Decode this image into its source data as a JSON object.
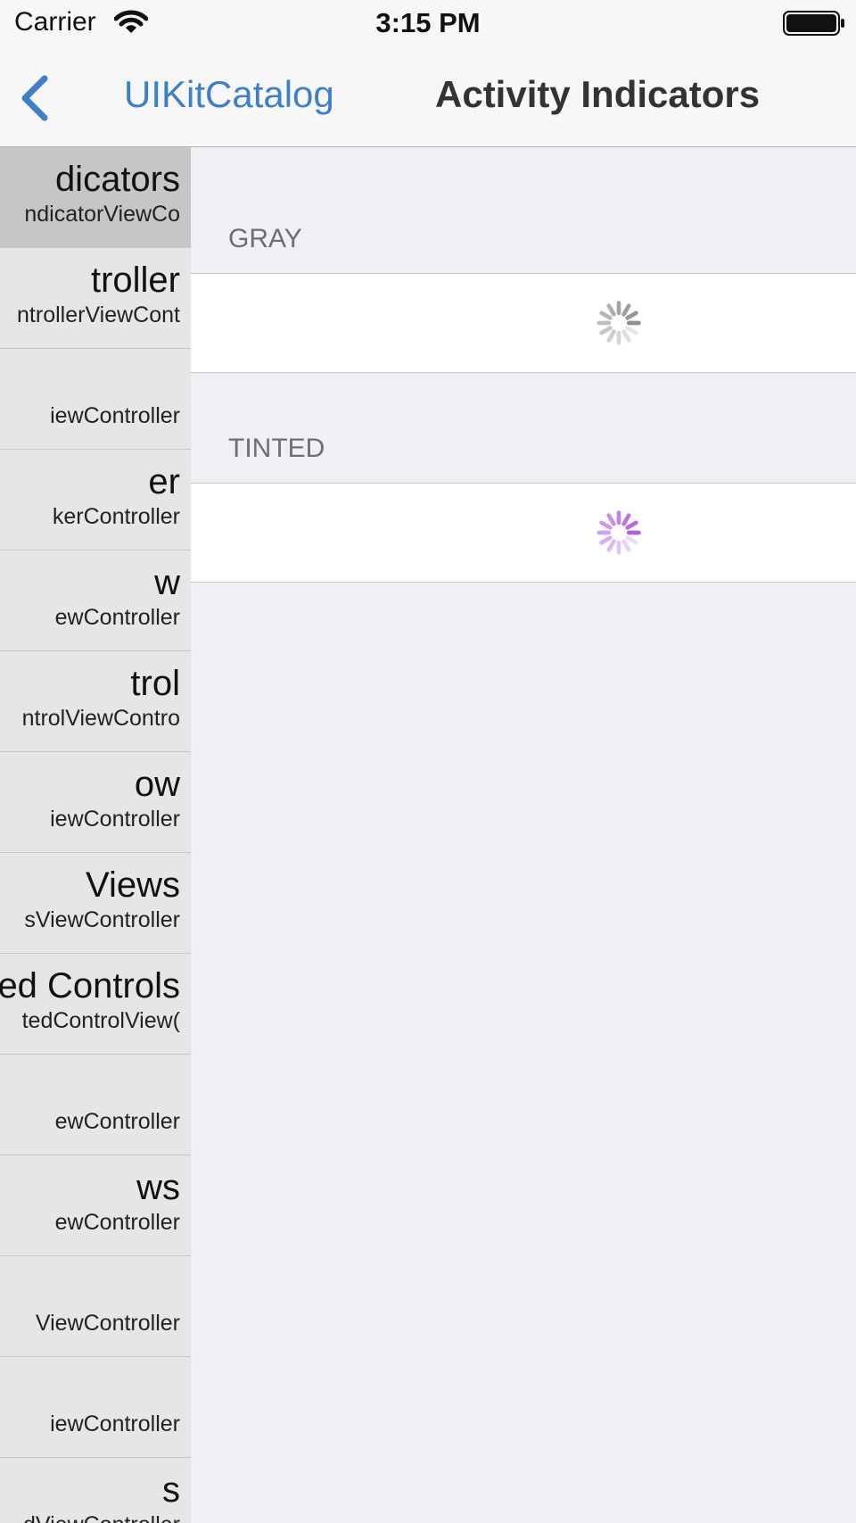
{
  "status_bar": {
    "carrier": "Carrier",
    "time": "3:15 PM"
  },
  "nav": {
    "back_label": "UIKitCatalog",
    "title": "Activity Indicators"
  },
  "sidebar": {
    "items": [
      {
        "title": "dicators",
        "subtitle": "ndicatorViewCo",
        "selected": true
      },
      {
        "title": "troller",
        "subtitle": "ntrollerViewCont"
      },
      {
        "title": "",
        "subtitle": "iewController"
      },
      {
        "title": "er",
        "subtitle": "kerController"
      },
      {
        "title": "w",
        "subtitle": "ewController"
      },
      {
        "title": "trol",
        "subtitle": "ntrolViewContro"
      },
      {
        "title": "ow",
        "subtitle": "iewController"
      },
      {
        "title": "Views",
        "subtitle": "sViewController"
      },
      {
        "title": "ed Controls",
        "subtitle": "tedControlView("
      },
      {
        "title": "",
        "subtitle": "ewController"
      },
      {
        "title": "ws",
        "subtitle": "ewController"
      },
      {
        "title": "",
        "subtitle": "ViewController"
      },
      {
        "title": "",
        "subtitle": "iewController"
      },
      {
        "title": "s",
        "subtitle": "dViewController"
      }
    ]
  },
  "sections": [
    {
      "header": "GRAY",
      "indicator_style": "gray",
      "color": "#8e8e93"
    },
    {
      "header": "TINTED",
      "indicator_style": "tinted",
      "color": "#b55fdc"
    }
  ]
}
